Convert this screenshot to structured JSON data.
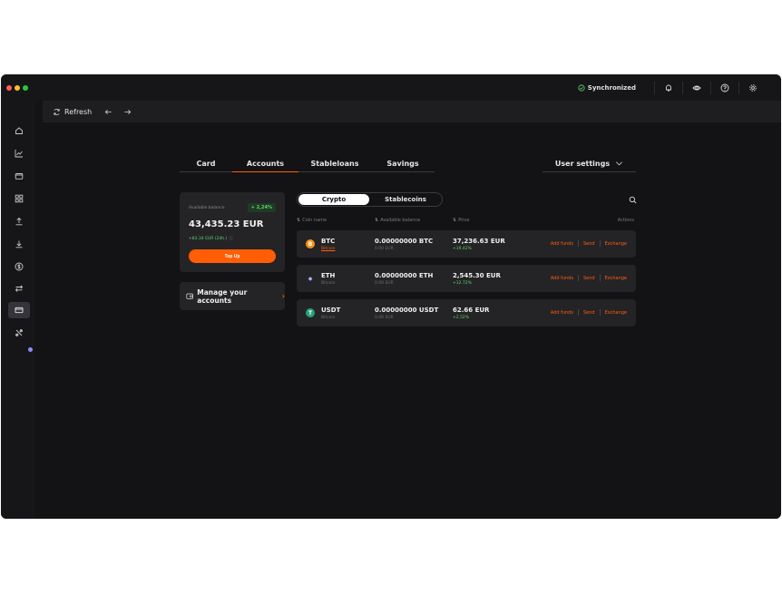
{
  "topbar": {
    "sync_label": "Synchronized",
    "icons": [
      "check-circle-icon",
      "bell-icon",
      "eye-icon",
      "help-icon",
      "gear-icon"
    ]
  },
  "toolbar": {
    "refresh_label": "Refresh"
  },
  "sidebar": {
    "items": [
      "home-icon",
      "chart-icon",
      "wallet-icon",
      "grid-icon",
      "upload-icon",
      "download-icon",
      "dollar-icon",
      "transfer-icon",
      "card-icon",
      "settings-tools-icon"
    ],
    "active_index": 8
  },
  "tabs": [
    {
      "label": "Card"
    },
    {
      "label": "Accounts",
      "active": true
    },
    {
      "label": "Stableloans"
    },
    {
      "label": "Savings"
    }
  ],
  "user_settings_label": "User settings",
  "balance": {
    "label": "Available balance",
    "badge": "+ 2,24%",
    "amount": "43,435.23 EUR",
    "change": "+83.34 EUR (24h.)",
    "topup_label": "Top Up"
  },
  "manage_label": "Manage your accounts",
  "segments": {
    "active": "Crypto",
    "inactive": "Stablecoins"
  },
  "table": {
    "headers": {
      "coin": "Coin name",
      "balance": "Available balance",
      "price": "Price",
      "actions": "Actions"
    },
    "rows": [
      {
        "symbol": "BTC",
        "name": "Bitcoin",
        "name_link": true,
        "balance": "0.00000000 BTC",
        "fiat": "0.00 EUR",
        "price": "37,236.63 EUR",
        "change": "+19.42%",
        "icon_color": "#f7931a",
        "icon_glyph": "B"
      },
      {
        "symbol": "ETH",
        "name": "Bitcoin",
        "name_link": false,
        "balance": "0.00000000 ETH",
        "fiat": "0.00 EUR",
        "price": "2,545.30 EUR",
        "change": "+12.72%",
        "icon_color": "#242427",
        "icon_glyph": "◆"
      },
      {
        "symbol": "USDT",
        "name": "Bitcoin",
        "name_link": false,
        "balance": "0.00000000 USDT",
        "fiat": "0.00 EUR",
        "price": "62.66 EUR",
        "change": "+2.52%",
        "icon_color": "#26a17b",
        "icon_glyph": "T"
      }
    ],
    "action_labels": {
      "add_funds": "Add funds",
      "send": "Send",
      "exchange": "Exchange"
    }
  },
  "colors": {
    "accent": "#ff5d06",
    "positive": "#5fd46e",
    "background": "#131315",
    "card": "#242427"
  }
}
